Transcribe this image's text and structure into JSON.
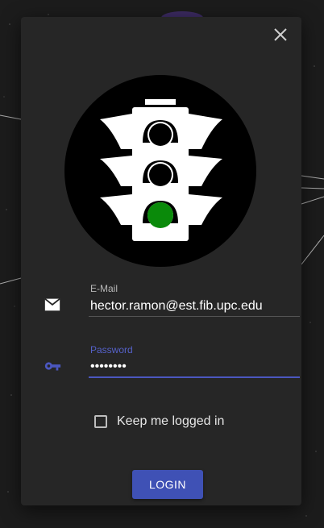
{
  "dialog": {
    "close_icon": "close-icon",
    "logo_icon": "traffic-light-icon",
    "logo_light_color": "#0a8a0a"
  },
  "email": {
    "icon": "mail-icon",
    "label": "E-Mail",
    "value": "hector.ramon@est.fib.upc.edu"
  },
  "password": {
    "icon": "key-icon",
    "label": "Password",
    "value": "••••••••"
  },
  "remember": {
    "label": "Keep me logged in",
    "checked": false
  },
  "login": {
    "label": "LOGIN",
    "color": "#3f51b5"
  },
  "accent_color": "#4b57c0"
}
